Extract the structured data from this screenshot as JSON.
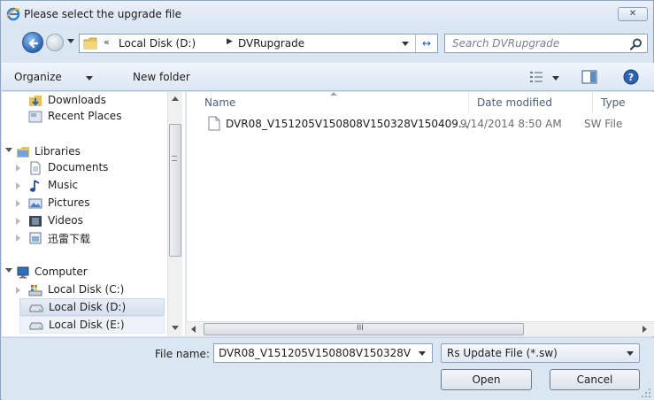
{
  "window": {
    "title": "Please select the upgrade file",
    "close_label": "✕"
  },
  "address": {
    "overflow": "«",
    "segments": [
      "Local Disk (D:)",
      "DVRupgrade"
    ],
    "separator": "▶",
    "refresh_glyph": "↔"
  },
  "search": {
    "placeholder": "Search DVRupgrade"
  },
  "toolbar": {
    "organize_label": "Organize",
    "new_folder_label": "New folder"
  },
  "nav": {
    "items": [
      {
        "label": "Downloads",
        "icon": "downloads-icon"
      },
      {
        "label": "Recent Places",
        "icon": "recent-places-icon"
      },
      {
        "label": "Libraries",
        "icon": "libraries-icon"
      },
      {
        "label": "Documents",
        "icon": "documents-icon"
      },
      {
        "label": "Music",
        "icon": "music-icon"
      },
      {
        "label": "Pictures",
        "icon": "pictures-icon"
      },
      {
        "label": "Videos",
        "icon": "videos-icon"
      },
      {
        "label": "迅雷下载",
        "icon": "thunder-download-icon"
      },
      {
        "label": "Computer",
        "icon": "computer-icon"
      },
      {
        "label": "Local Disk (C:)",
        "icon": "system-drive-icon"
      },
      {
        "label": "Local Disk (D:)",
        "icon": "drive-icon",
        "selected": true
      },
      {
        "label": "Local Disk (E:)",
        "icon": "drive-icon"
      }
    ]
  },
  "columns": {
    "name": "Name",
    "date_modified": "Date modified",
    "type": "Type"
  },
  "files": [
    {
      "name": "DVR08_V151205V150808V150328V150409...",
      "date_modified": "9/14/2014 8:50 AM",
      "type": "SW File"
    }
  ],
  "hscroll": {
    "grip_glyph": "III"
  },
  "footer": {
    "file_name_label": "File name:",
    "file_name_value": "DVR08_V151205V150808V150328V1",
    "file_type_value": "Rs Update File (*.sw)",
    "open_label": "Open",
    "cancel_label": "Cancel"
  }
}
